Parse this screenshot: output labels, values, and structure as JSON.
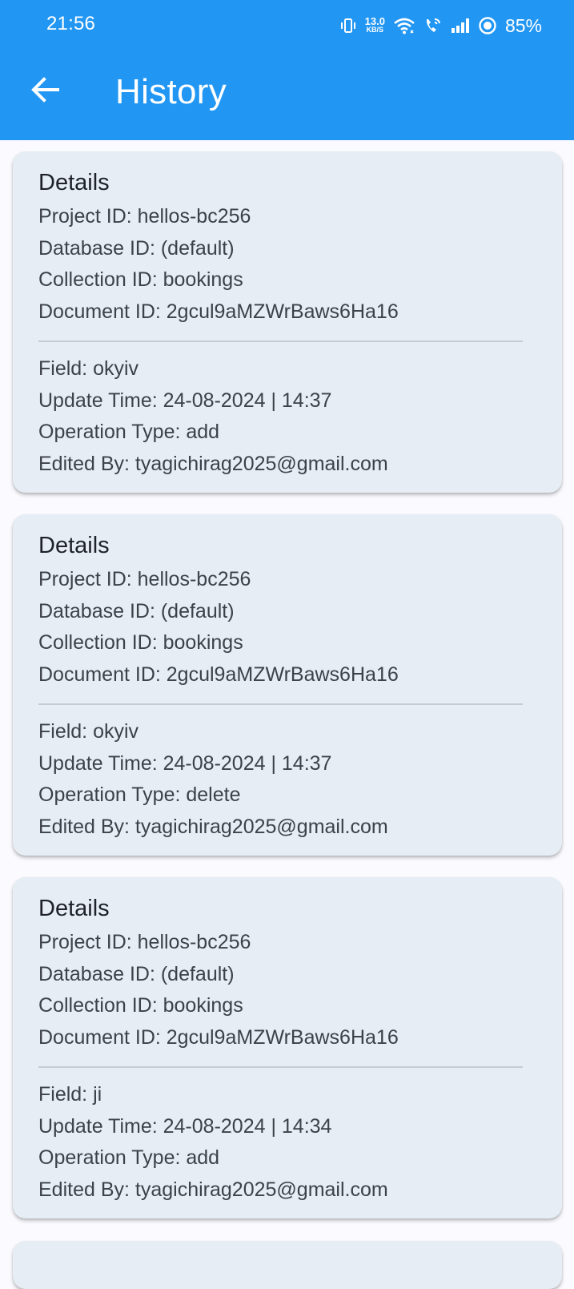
{
  "status_bar": {
    "time": "21:56",
    "net_speed_value": "13.0",
    "net_speed_unit": "KB/S",
    "battery": "85%",
    "icons": [
      "vibrate-icon",
      "wifi-icon",
      "wifi-calling-icon",
      "signal-icon",
      "battery-saver-icon"
    ]
  },
  "app_bar": {
    "title": "History",
    "back_icon": "arrow-left-icon",
    "color": "#2196f3"
  },
  "history": [
    {
      "heading": "Details",
      "project": "Project ID: hellos-bc256",
      "database": "Database ID: (default)",
      "collection": "Collection ID: bookings",
      "document": "Document ID: 2gcul9aMZWrBaws6Ha16",
      "field": "Field: okyiv",
      "update_time": "Update Time: 24-08-2024 | 14:37",
      "operation": "Operation Type: add",
      "edited_by": "Edited By: tyagichirag2025@gmail.com"
    },
    {
      "heading": "Details",
      "project": "Project ID: hellos-bc256",
      "database": "Database ID: (default)",
      "collection": "Collection ID: bookings",
      "document": "Document ID: 2gcul9aMZWrBaws6Ha16",
      "field": "Field: okyiv",
      "update_time": "Update Time: 24-08-2024 | 14:37",
      "operation": "Operation Type: delete",
      "edited_by": "Edited By: tyagichirag2025@gmail.com"
    },
    {
      "heading": "Details",
      "project": "Project ID: hellos-bc256",
      "database": "Database ID: (default)",
      "collection": "Collection ID: bookings",
      "document": "Document ID: 2gcul9aMZWrBaws6Ha16",
      "field": "Field: ji",
      "update_time": "Update Time: 24-08-2024 | 14:34",
      "operation": "Operation Type: add",
      "edited_by": "Edited By: tyagichirag2025@gmail.com"
    }
  ]
}
